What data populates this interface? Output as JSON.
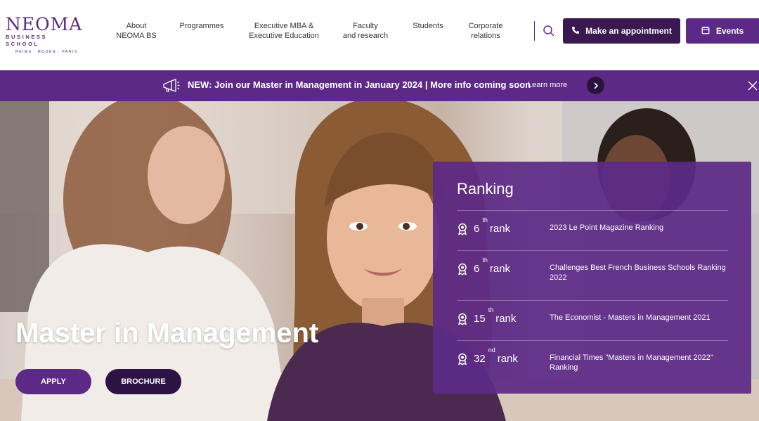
{
  "logo": {
    "name": "NEOMA",
    "sub": "BUSINESS SCHOOL",
    "cities": "REIMS · ROUEN · PARIS"
  },
  "nav": [
    {
      "line1": "About",
      "line2": "NEOMA BS"
    },
    {
      "line1": "Programmes",
      "line2": ""
    },
    {
      "line1": "Executive MBA &",
      "line2": "Executive Education"
    },
    {
      "line1": "Faculty",
      "line2": "and research"
    },
    {
      "line1": "Students",
      "line2": ""
    },
    {
      "line1": "Corporate",
      "line2": "relations"
    }
  ],
  "header_actions": {
    "search_icon": "search-icon",
    "appointment_label": "Make an appointment",
    "appointment_icon": "phone-icon",
    "events_label": "Events",
    "events_icon": "calendar-icon"
  },
  "banner": {
    "text": "NEW: Join our Master in Management in January 2024 | More info coming soon",
    "learn_more": "Learn more",
    "icon": "megaphone-icon",
    "arrow_icon": "chevron-right-icon",
    "close_icon": "close-icon"
  },
  "hero": {
    "title": "Master in Management",
    "apply_label": "APPLY",
    "brochure_label": "BROCHURE"
  },
  "ranking": {
    "title": "Ranking",
    "rank_word": "rank",
    "icon": "award-icon",
    "items": [
      {
        "number": "6",
        "suffix": "th",
        "description": "2023 Le Point Magazine Ranking"
      },
      {
        "number": "6",
        "suffix": "th",
        "description": "Challenges Best French Business Schools Ranking 2022"
      },
      {
        "number": "15",
        "suffix": "th",
        "description": "The Economist - Masters in Management 2021"
      },
      {
        "number": "32",
        "suffix": "nd",
        "description": "Financial Times \"Masters in Management 2022\" Ranking"
      }
    ]
  },
  "colors": {
    "brand_purple": "#5c2a86",
    "dark_purple": "#3a1852",
    "text": "#333333"
  }
}
